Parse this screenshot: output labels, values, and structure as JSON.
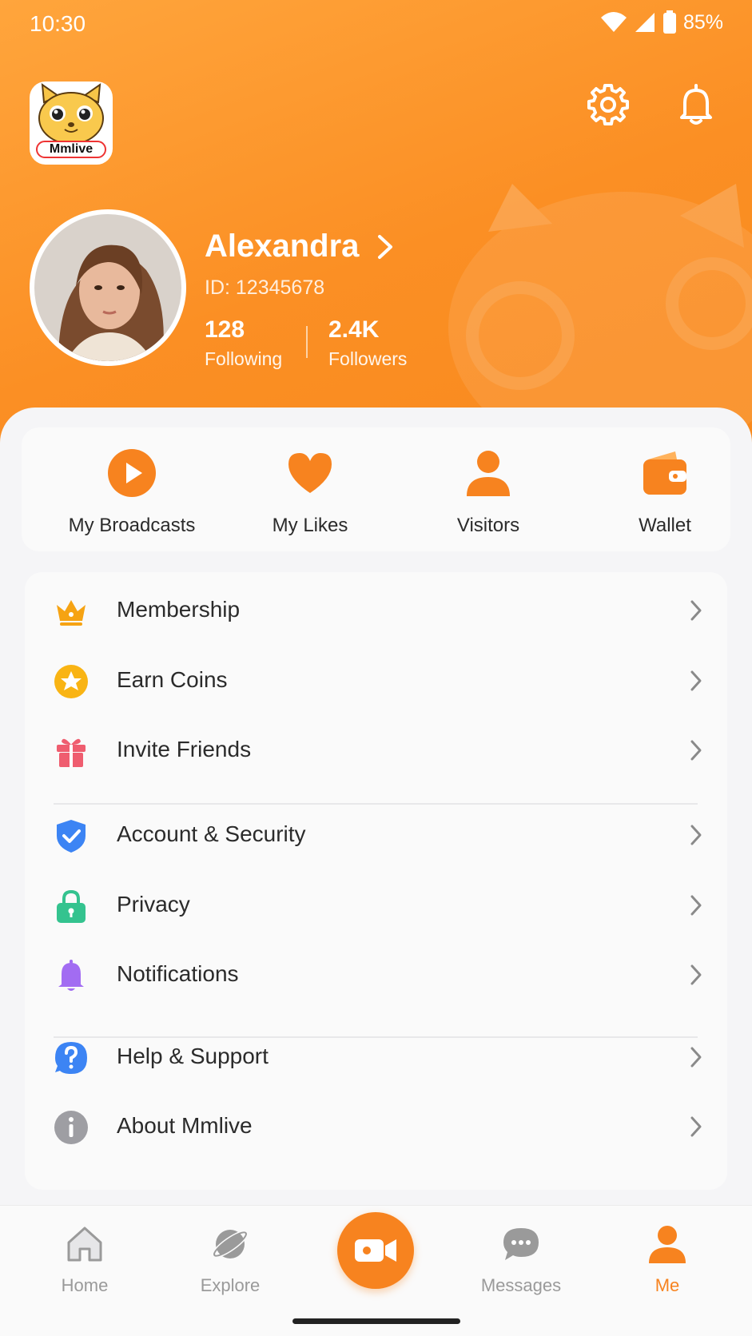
{
  "status_bar": {
    "time": "10:30",
    "battery": "85%"
  },
  "app": {
    "logo_text": "Mmlive"
  },
  "profile": {
    "name": "Alexandra",
    "id_text": "ID: 12345678",
    "following_count": "128",
    "following_label": "Following",
    "followers_count": "2.4K",
    "followers_label": "Followers"
  },
  "quick_actions": [
    {
      "label": "My Broadcasts",
      "icon": "play-circle-icon"
    },
    {
      "label": "My Likes",
      "icon": "heart-icon"
    },
    {
      "label": "Visitors",
      "icon": "person-icon"
    },
    {
      "label": "Wallet",
      "icon": "wallet-icon"
    }
  ],
  "menu": [
    {
      "label": "Membership",
      "icon": "crown-icon"
    },
    {
      "label": "Earn Coins",
      "icon": "star-coin-icon"
    },
    {
      "label": "Invite Friends",
      "icon": "gift-icon"
    },
    {
      "label": "Account & Security",
      "icon": "shield-check-icon"
    },
    {
      "label": "Privacy",
      "icon": "lock-icon"
    },
    {
      "label": "Notifications",
      "icon": "bell-icon"
    },
    {
      "label": "Help & Support",
      "icon": "help-bubble-icon"
    },
    {
      "label": "About Mmlive",
      "icon": "info-icon"
    }
  ],
  "bottom_nav": [
    {
      "label": "Home",
      "icon": "home-icon"
    },
    {
      "label": "Explore",
      "icon": "planet-icon"
    },
    {
      "label": "",
      "icon": "live-camera-icon"
    },
    {
      "label": "Messages",
      "icon": "chat-bubble-icon"
    },
    {
      "label": "Me",
      "icon": "person-icon",
      "active": true
    }
  ],
  "colors": {
    "accent": "#f7831f",
    "header": "#fb8f24"
  }
}
